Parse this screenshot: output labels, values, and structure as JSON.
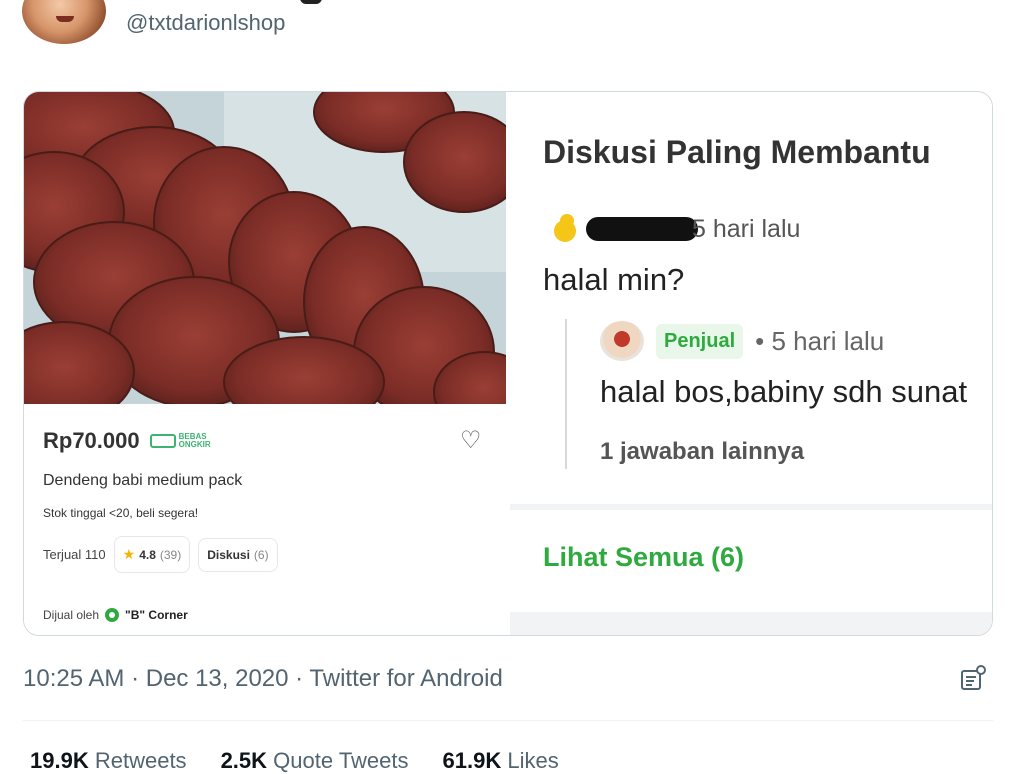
{
  "tweet": {
    "handle": "@txtdarionlshop",
    "timestamp": "10:25 AM · Dec 13, 2020 · Twitter for Android",
    "stats": {
      "retweets_count": "19.9K",
      "retweets_label": "Retweets",
      "quotes_count": "2.5K",
      "quotes_label": "Quote Tweets",
      "likes_count": "61.9K",
      "likes_label": "Likes"
    }
  },
  "product": {
    "price": "Rp70.000",
    "shipping_badge_line1": "BEBAS",
    "shipping_badge_line2": "ONGKIR",
    "name": "Dendeng babi medium pack",
    "stock": "Stok tinggal <20, beli segera!",
    "sold": "Terjual 110",
    "rating": "4.8",
    "rating_count": "(39)",
    "discussion_label": "Diskusi",
    "discussion_count": "(6)",
    "seller_prefix": "Dijual oleh",
    "seller_name": "\"B\" Corner"
  },
  "discussion": {
    "title": "Diskusi Paling Membantu",
    "question_time": "5 hari lalu",
    "question": "halal min?",
    "seller_badge": "Penjual",
    "reply_time": "• 5 hari lalu",
    "reply": "halal bos,babiny sdh sunat",
    "more_answers": "1 jawaban lainnya",
    "see_all": "Lihat Semua (6)"
  },
  "colors": {
    "green": "#2eaa3f",
    "muted": "#536471"
  },
  "icons": [
    "heart-icon",
    "star-icon",
    "truck-icon",
    "seller-badge-icon",
    "analytics-icon"
  ]
}
